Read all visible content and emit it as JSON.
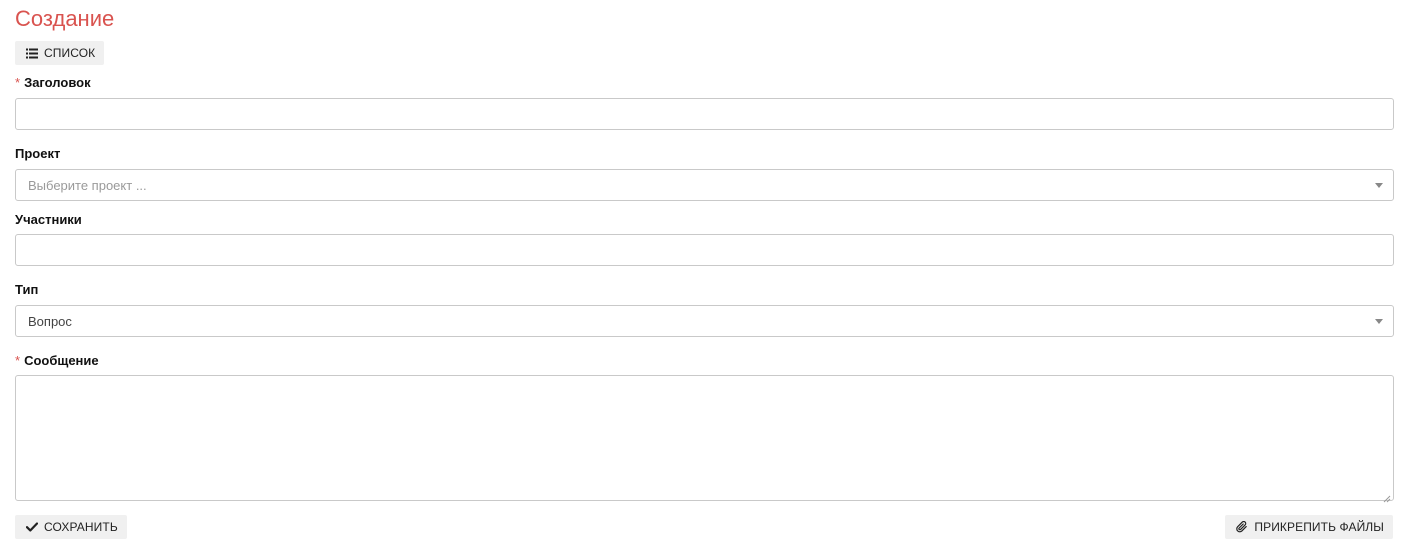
{
  "page": {
    "title": "Создание",
    "accent_color": "#d9534f"
  },
  "toolbar": {
    "list_label": "СПИСОК",
    "list_icon": "list-icon"
  },
  "form": {
    "title_field": {
      "label": "Заголовок",
      "required": "*",
      "value": ""
    },
    "project_field": {
      "label": "Проект",
      "placeholder": "Выберите проект ..."
    },
    "participants_field": {
      "label": "Участники",
      "value": ""
    },
    "type_field": {
      "label": "Тип",
      "selected": "Вопрос"
    },
    "message_field": {
      "label": "Сообщение",
      "required": "*",
      "value": ""
    }
  },
  "actions": {
    "save_label": "СОХРАНИТЬ",
    "save_icon": "check-icon",
    "attach_label": "ПРИКРЕПИТЬ ФАЙЛЫ",
    "attach_icon": "paperclip-icon"
  }
}
